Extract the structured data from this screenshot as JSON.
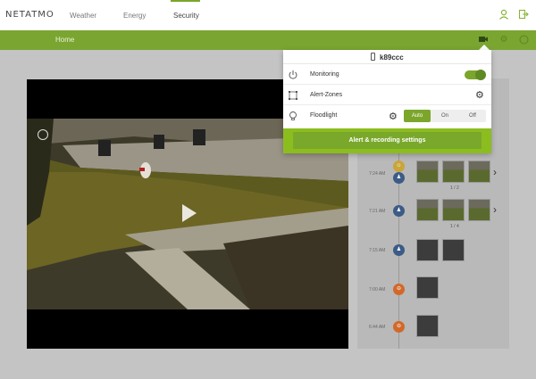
{
  "nav": {
    "brand": "NETATMO",
    "items": [
      {
        "label": "Weather"
      },
      {
        "label": "Energy"
      },
      {
        "label": "Security"
      }
    ]
  },
  "subnav": {
    "home_label": "Home"
  },
  "popup": {
    "camera_name": "k89ccc",
    "rows": [
      {
        "label": "Monitoring",
        "icon": "power-icon",
        "toggle_on": true
      },
      {
        "label": "Alert-Zones",
        "icon": "zones-icon"
      },
      {
        "label": "Floodlight",
        "icon": "bulb-icon"
      }
    ],
    "floodlight_modes": [
      "Auto",
      "On",
      "Off"
    ],
    "floodlight_selected": "Auto",
    "settings_button": "Alert & recording settings"
  },
  "timeline": {
    "events": [
      {
        "time": "7:24 AM",
        "count": "1 / 2"
      },
      {
        "time": "7:21 AM",
        "count": "1 / 4"
      },
      {
        "time": "7:15 AM"
      },
      {
        "time": "7:00 AM"
      },
      {
        "time": "6:44 AM"
      }
    ]
  },
  "colors": {
    "accent": "#7aa531",
    "popup_footer": "#8cbd1f",
    "badge_blue": "#3c5b86",
    "badge_orange": "#d2692a"
  }
}
